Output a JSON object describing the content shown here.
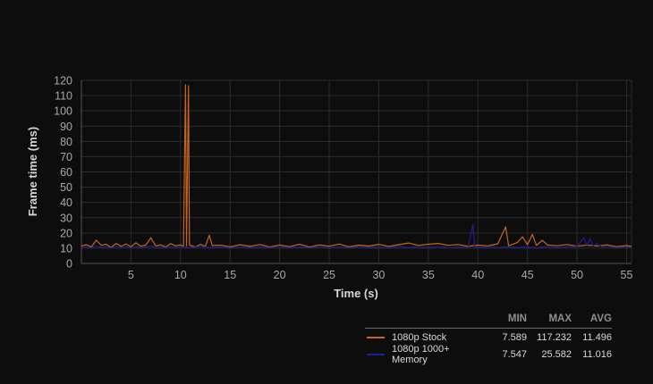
{
  "chart_data": {
    "type": "line",
    "title": "",
    "xlabel": "Time (s)",
    "ylabel": "Frame time (ms)",
    "xlim": [
      0,
      55.5
    ],
    "ylim": [
      0,
      120
    ],
    "x_ticks": [
      5,
      10,
      15,
      20,
      25,
      30,
      35,
      40,
      45,
      50,
      55
    ],
    "y_ticks": [
      0,
      10,
      20,
      30,
      40,
      50,
      60,
      70,
      80,
      90,
      100,
      110,
      120
    ],
    "grid": true,
    "legend_position": "bottom-right",
    "legend_columns": [
      "MIN",
      "MAX",
      "AVG"
    ],
    "series": [
      {
        "name": "1080p Stock",
        "color": "#c8641e",
        "stats": {
          "min": "7.589",
          "max": "117.232",
          "avg": "11.496"
        },
        "points": [
          [
            0,
            11.5
          ],
          [
            0.5,
            12.3
          ],
          [
            1,
            10.8
          ],
          [
            1.5,
            15.2
          ],
          [
            2,
            11.9
          ],
          [
            2.5,
            12.6
          ],
          [
            3,
            10.4
          ],
          [
            3.5,
            13.1
          ],
          [
            4,
            11.2
          ],
          [
            4.5,
            12.8
          ],
          [
            5,
            10.9
          ],
          [
            5.5,
            13.5
          ],
          [
            6,
            11.3
          ],
          [
            6.5,
            12.0
          ],
          [
            7,
            16.8
          ],
          [
            7.5,
            11.4
          ],
          [
            8,
            12.2
          ],
          [
            8.5,
            10.7
          ],
          [
            9,
            13.0
          ],
          [
            9.5,
            11.6
          ],
          [
            10,
            12.1
          ],
          [
            10.3,
            11.0
          ],
          [
            10.5,
            117.2
          ],
          [
            10.6,
            11.5
          ],
          [
            10.8,
            116.5
          ],
          [
            10.9,
            12.0
          ],
          [
            11.5,
            10.8
          ],
          [
            12,
            12.5
          ],
          [
            12.5,
            11.1
          ],
          [
            12.9,
            18.5
          ],
          [
            13.2,
            11.7
          ],
          [
            14,
            12.0
          ],
          [
            15,
            10.9
          ],
          [
            16,
            12.3
          ],
          [
            17,
            11.2
          ],
          [
            18,
            12.4
          ],
          [
            19,
            10.8
          ],
          [
            20,
            12.1
          ],
          [
            21,
            11.0
          ],
          [
            22,
            12.6
          ],
          [
            23,
            10.7
          ],
          [
            24,
            12.2
          ],
          [
            25,
            11.3
          ],
          [
            26,
            12.7
          ],
          [
            27,
            10.9
          ],
          [
            28,
            12.0
          ],
          [
            29,
            11.4
          ],
          [
            30,
            12.5
          ],
          [
            31,
            11.1
          ],
          [
            32,
            12.3
          ],
          [
            33,
            13.4
          ],
          [
            34,
            11.8
          ],
          [
            35,
            12.6
          ],
          [
            36,
            13.1
          ],
          [
            37,
            11.9
          ],
          [
            38,
            12.4
          ],
          [
            39,
            11.2
          ],
          [
            40,
            12.0
          ],
          [
            41,
            11.5
          ],
          [
            42,
            12.8
          ],
          [
            42.8,
            24.0
          ],
          [
            43.1,
            11.6
          ],
          [
            44,
            13.8
          ],
          [
            44.5,
            17.5
          ],
          [
            45,
            12.3
          ],
          [
            45.5,
            19.0
          ],
          [
            45.9,
            11.8
          ],
          [
            46.5,
            15.2
          ],
          [
            47,
            12.1
          ],
          [
            48,
            11.6
          ],
          [
            49,
            12.4
          ],
          [
            50,
            11.3
          ],
          [
            51,
            12.0
          ],
          [
            52,
            11.4
          ],
          [
            53,
            12.2
          ],
          [
            54,
            11.0
          ],
          [
            55,
            11.7
          ],
          [
            55.5,
            11.2
          ]
        ]
      },
      {
        "name": "1080p 1000+ Memory",
        "color": "#1e1e96",
        "stats": {
          "min": "7.547",
          "max": "25.582",
          "avg": "11.016"
        },
        "points": [
          [
            0,
            10.5
          ],
          [
            0.5,
            11.0
          ],
          [
            1,
            10.2
          ],
          [
            1.5,
            11.3
          ],
          [
            2,
            10.6
          ],
          [
            2.5,
            10.9
          ],
          [
            3,
            10.1
          ],
          [
            3.5,
            11.2
          ],
          [
            4,
            10.4
          ],
          [
            4.5,
            11.0
          ],
          [
            5,
            10.3
          ],
          [
            5.5,
            11.1
          ],
          [
            6,
            10.5
          ],
          [
            6.5,
            10.8
          ],
          [
            7,
            11.4
          ],
          [
            7.5,
            10.2
          ],
          [
            8,
            10.9
          ],
          [
            8.5,
            10.4
          ],
          [
            9,
            11.0
          ],
          [
            9.5,
            10.6
          ],
          [
            10,
            10.9
          ],
          [
            11,
            10.3
          ],
          [
            12,
            11.1
          ],
          [
            13,
            10.5
          ],
          [
            14,
            10.8
          ],
          [
            15,
            10.2
          ],
          [
            16,
            11.0
          ],
          [
            17,
            10.4
          ],
          [
            18,
            10.9
          ],
          [
            19,
            10.3
          ],
          [
            20,
            11.0
          ],
          [
            21,
            10.5
          ],
          [
            22,
            10.8
          ],
          [
            23,
            10.2
          ],
          [
            24,
            11.1
          ],
          [
            25,
            10.4
          ],
          [
            26,
            10.9
          ],
          [
            27,
            10.3
          ],
          [
            28,
            11.0
          ],
          [
            29,
            10.6
          ],
          [
            30,
            10.8
          ],
          [
            31,
            10.2
          ],
          [
            32,
            11.1
          ],
          [
            33,
            10.4
          ],
          [
            34,
            10.9
          ],
          [
            35,
            10.5
          ],
          [
            36,
            11.0
          ],
          [
            37,
            10.3
          ],
          [
            38,
            10.8
          ],
          [
            39,
            10.4
          ],
          [
            39.5,
            25.6
          ],
          [
            39.7,
            10.9
          ],
          [
            40.5,
            10.5
          ],
          [
            41,
            11.0
          ],
          [
            42,
            10.4
          ],
          [
            43,
            10.9
          ],
          [
            44,
            10.5
          ],
          [
            45,
            10.8
          ],
          [
            46,
            10.3
          ],
          [
            47,
            11.0
          ],
          [
            48,
            10.5
          ],
          [
            49,
            10.9
          ],
          [
            50,
            11.1
          ],
          [
            50.7,
            17.0
          ],
          [
            51,
            11.8
          ],
          [
            51.3,
            16.2
          ],
          [
            51.6,
            11.5
          ],
          [
            52,
            13.0
          ],
          [
            52.5,
            10.8
          ],
          [
            53,
            11.2
          ],
          [
            54,
            10.4
          ],
          [
            55,
            10.9
          ],
          [
            55.5,
            10.6
          ]
        ]
      }
    ]
  }
}
